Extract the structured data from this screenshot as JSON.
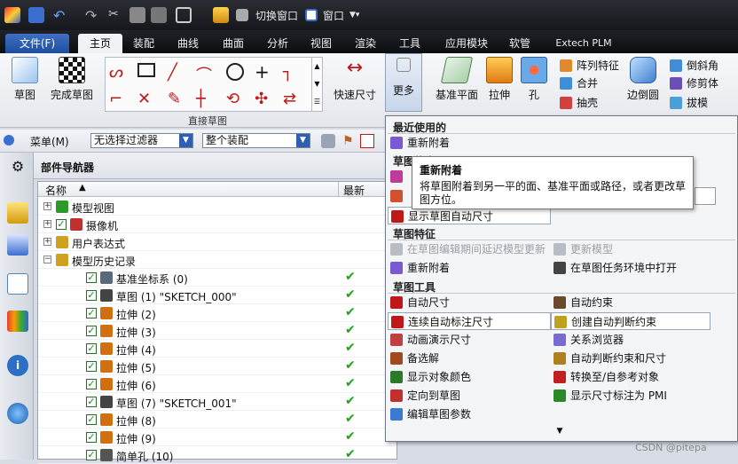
{
  "qat": {
    "switch_window": "切换窗口",
    "window_menu": "窗口"
  },
  "tabs": [
    "文件(F)",
    "主页",
    "装配",
    "曲线",
    "曲面",
    "分析",
    "视图",
    "渲染",
    "工具",
    "应用模块",
    "软管",
    "Extech PLM"
  ],
  "ribbon": {
    "sketch": "草图",
    "finish_sketch": "完成草图",
    "group_label": "直接草图",
    "quick_dim": "快速尺寸",
    "more": "更多",
    "datum_plane": "基准平面",
    "extrude": "拉伸",
    "hole": "孔",
    "pattern_feature": "阵列特征",
    "unite": "合并",
    "shell": "抽壳",
    "edge_blend": "边倒圆",
    "chamfer": "倒斜角",
    "trim_body": "修剪体",
    "draft": "拔模"
  },
  "toolbar2": {
    "menu": "菜单(M)",
    "filter": "无选择过滤器",
    "scope": "整个装配"
  },
  "nav": {
    "title": "部件导航器",
    "col_name": "名称",
    "col_latest": "最新",
    "rows": [
      {
        "label": "模型视图",
        "latest": ""
      },
      {
        "label": "摄像机",
        "latest": ""
      },
      {
        "label": "用户表达式",
        "latest": ""
      },
      {
        "label": "模型历史记录",
        "latest": ""
      },
      {
        "label": "基准坐标系 (0)",
        "latest": "✔"
      },
      {
        "label": "草图 (1) \"SKETCH_000\"",
        "latest": "✔"
      },
      {
        "label": "拉伸 (2)",
        "latest": "✔"
      },
      {
        "label": "拉伸 (3)",
        "latest": "✔"
      },
      {
        "label": "拉伸 (4)",
        "latest": "✔"
      },
      {
        "label": "拉伸 (5)",
        "latest": "✔"
      },
      {
        "label": "拉伸 (6)",
        "latest": "✔"
      },
      {
        "label": "草图 (7) \"SKETCH_001\"",
        "latest": "✔"
      },
      {
        "label": "拉伸 (8)",
        "latest": "✔"
      },
      {
        "label": "拉伸 (9)",
        "latest": "✔"
      },
      {
        "label": "简单孔 (10)",
        "latest": "✔"
      }
    ]
  },
  "menu": {
    "recent_header": "最近使用的",
    "recent_reattach": "重新附着",
    "partial_header": "草图约束",
    "show_auto_dim": "显示草图自动尺寸",
    "feature_header": "草图特征",
    "delay_update": "在草图编辑期间延迟模型更新",
    "update_model": "更新模型",
    "reattach": "重新附着",
    "open_task_env": "在草图任务环境中打开",
    "tools_header": "草图工具",
    "auto_dim": "自动尺寸",
    "auto_constraint": "自动约束",
    "continuous_auto_dim": "连续自动标注尺寸",
    "create_inferred": "创建自动判断约束",
    "animate_dim": "动画演示尺寸",
    "relations_browser": "关系浏览器",
    "alternate_solution": "备选解",
    "infer_constraints_dims": "自动判断约束和尺寸",
    "show_object_color": "显示对象颜色",
    "convert_ref": "转换至/自参考对象",
    "orient_to_sketch": "定向到草图",
    "dim_as_pmi": "显示尺寸标注为 PMI",
    "edit_params": "编辑草图参数"
  },
  "tooltip": {
    "title": "重新附着",
    "body": "将草图附着到另一平的面、基准平面或路径，或者更改草图方位。"
  },
  "watermark": "CSDN @pitepa"
}
